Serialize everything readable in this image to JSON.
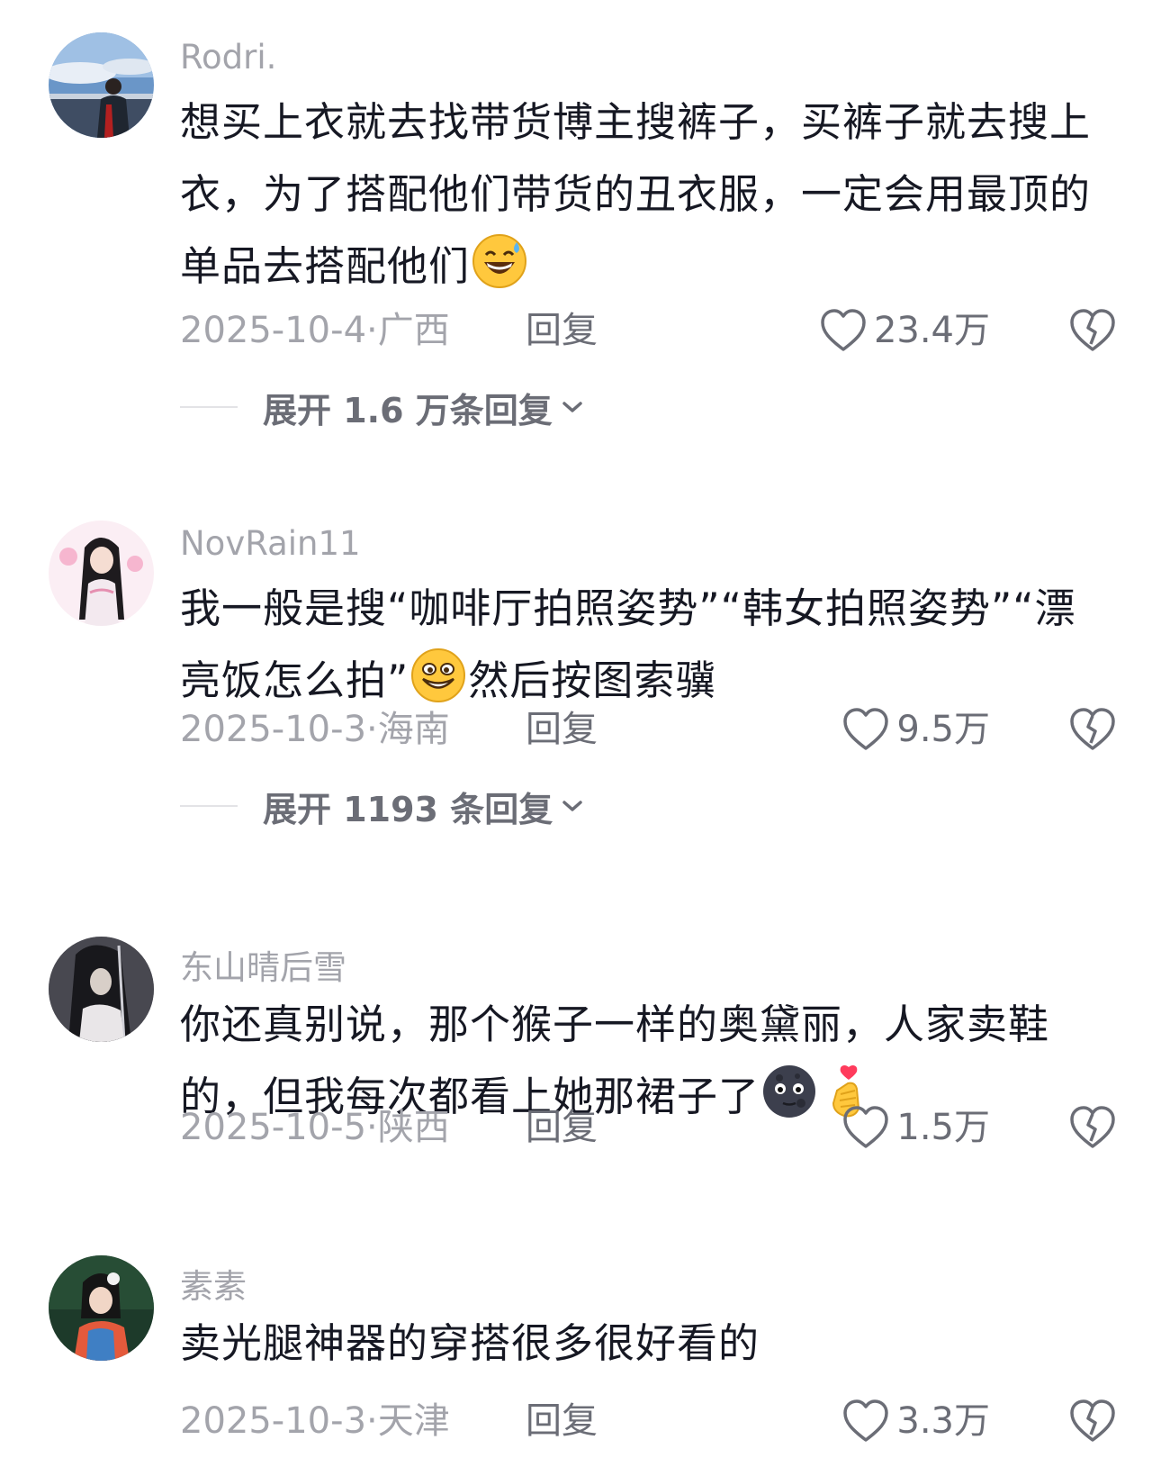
{
  "comments": [
    {
      "username": "Rodri.",
      "text_1": "想买上衣就去找带货博主搜裤子，买裤子就去搜上衣，为了搭配他们带货的丑衣服，一定会用最顶的单品去搭配他们",
      "text_2": "",
      "emoji_1": "grinning-sweat-emoji",
      "emoji_2": "",
      "date": "2025-10-4",
      "location": "广西",
      "reply_label": "回复",
      "likes": "23.4万",
      "expand_label": "展开 1.6 万条回复"
    },
    {
      "username": "NovRain11",
      "text_1": "我一般是搜“咖啡厅拍照姿势”“韩女拍照姿势”“漂亮饭怎么拍”",
      "text_2": "然后按图索骥",
      "emoji_1": "silly-grin-emoji",
      "emoji_2": "",
      "date": "2025-10-3",
      "location": "海南",
      "reply_label": "回复",
      "likes": "9.5万",
      "expand_label": "展开 1193 条回复"
    },
    {
      "username": "东山晴后雪",
      "text_1": "你还真别说，那个猴子一样的奥黛丽，人家卖鞋的，但我每次都看上她那裙子了",
      "text_2": "",
      "emoji_1": "dark-moon-face-emoji",
      "emoji_2": "finger-heart-emoji",
      "date": "2025-10-5",
      "location": "陕西",
      "reply_label": "回复",
      "likes": "1.5万",
      "expand_label": ""
    },
    {
      "username": "素素",
      "text_1": "卖光腿神器的穿搭很多很好看的",
      "text_2": "",
      "emoji_1": "",
      "emoji_2": "",
      "date": "2025-10-3",
      "location": "天津",
      "reply_label": "回复",
      "likes": "3.3万",
      "expand_label": ""
    }
  ],
  "meta_separator": "·",
  "icons": {
    "like": "heart-outline-icon",
    "dislike": "broken-heart-icon",
    "expand": "chevron-down-icon"
  },
  "colors": {
    "primary_text": "#161823",
    "secondary_text": "#a3a4ab",
    "action_text": "#6b6d76"
  }
}
